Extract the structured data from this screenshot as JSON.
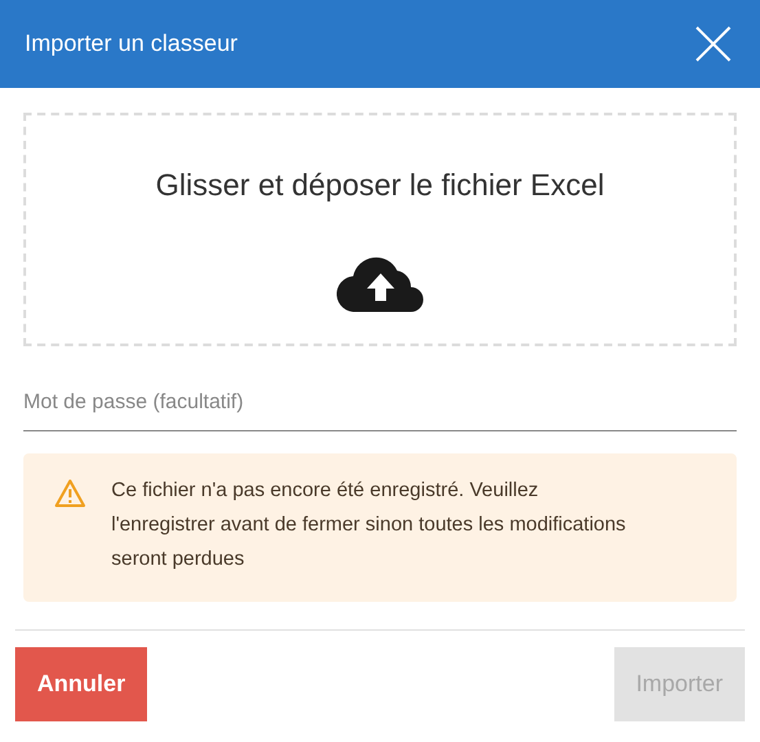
{
  "dialog": {
    "title": "Importer un classeur"
  },
  "dropzone": {
    "text": "Glisser et déposer le fichier Excel"
  },
  "password": {
    "placeholder": "Mot de passe (facultatif)"
  },
  "warning": {
    "text": "Ce fichier n'a pas encore été enregistré. Veuillez l'enregistrer avant de fermer sinon toutes les modifications seront perdues"
  },
  "buttons": [
    {
      "label": "Annuler",
      "kind": "cancel",
      "disabled": false
    },
    {
      "label": "Importer",
      "kind": "primary",
      "disabled": true
    }
  ]
}
